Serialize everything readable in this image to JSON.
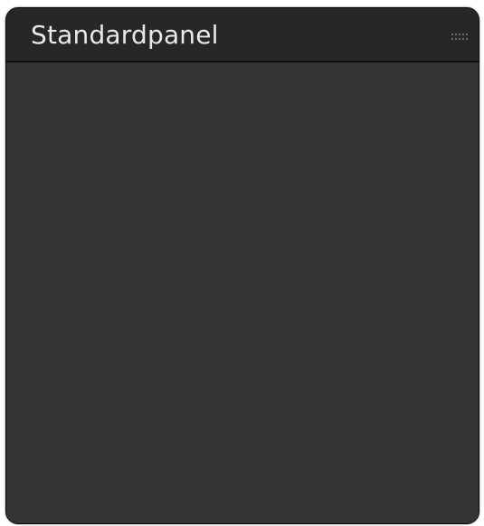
{
  "panel": {
    "title": "Standardpanel",
    "grip_icon": "drag-handle-dots",
    "colors": {
      "body": "#333333",
      "titlebar": "#272727",
      "title_text": "#e9e9e9",
      "border": "#0c0c0c"
    }
  }
}
